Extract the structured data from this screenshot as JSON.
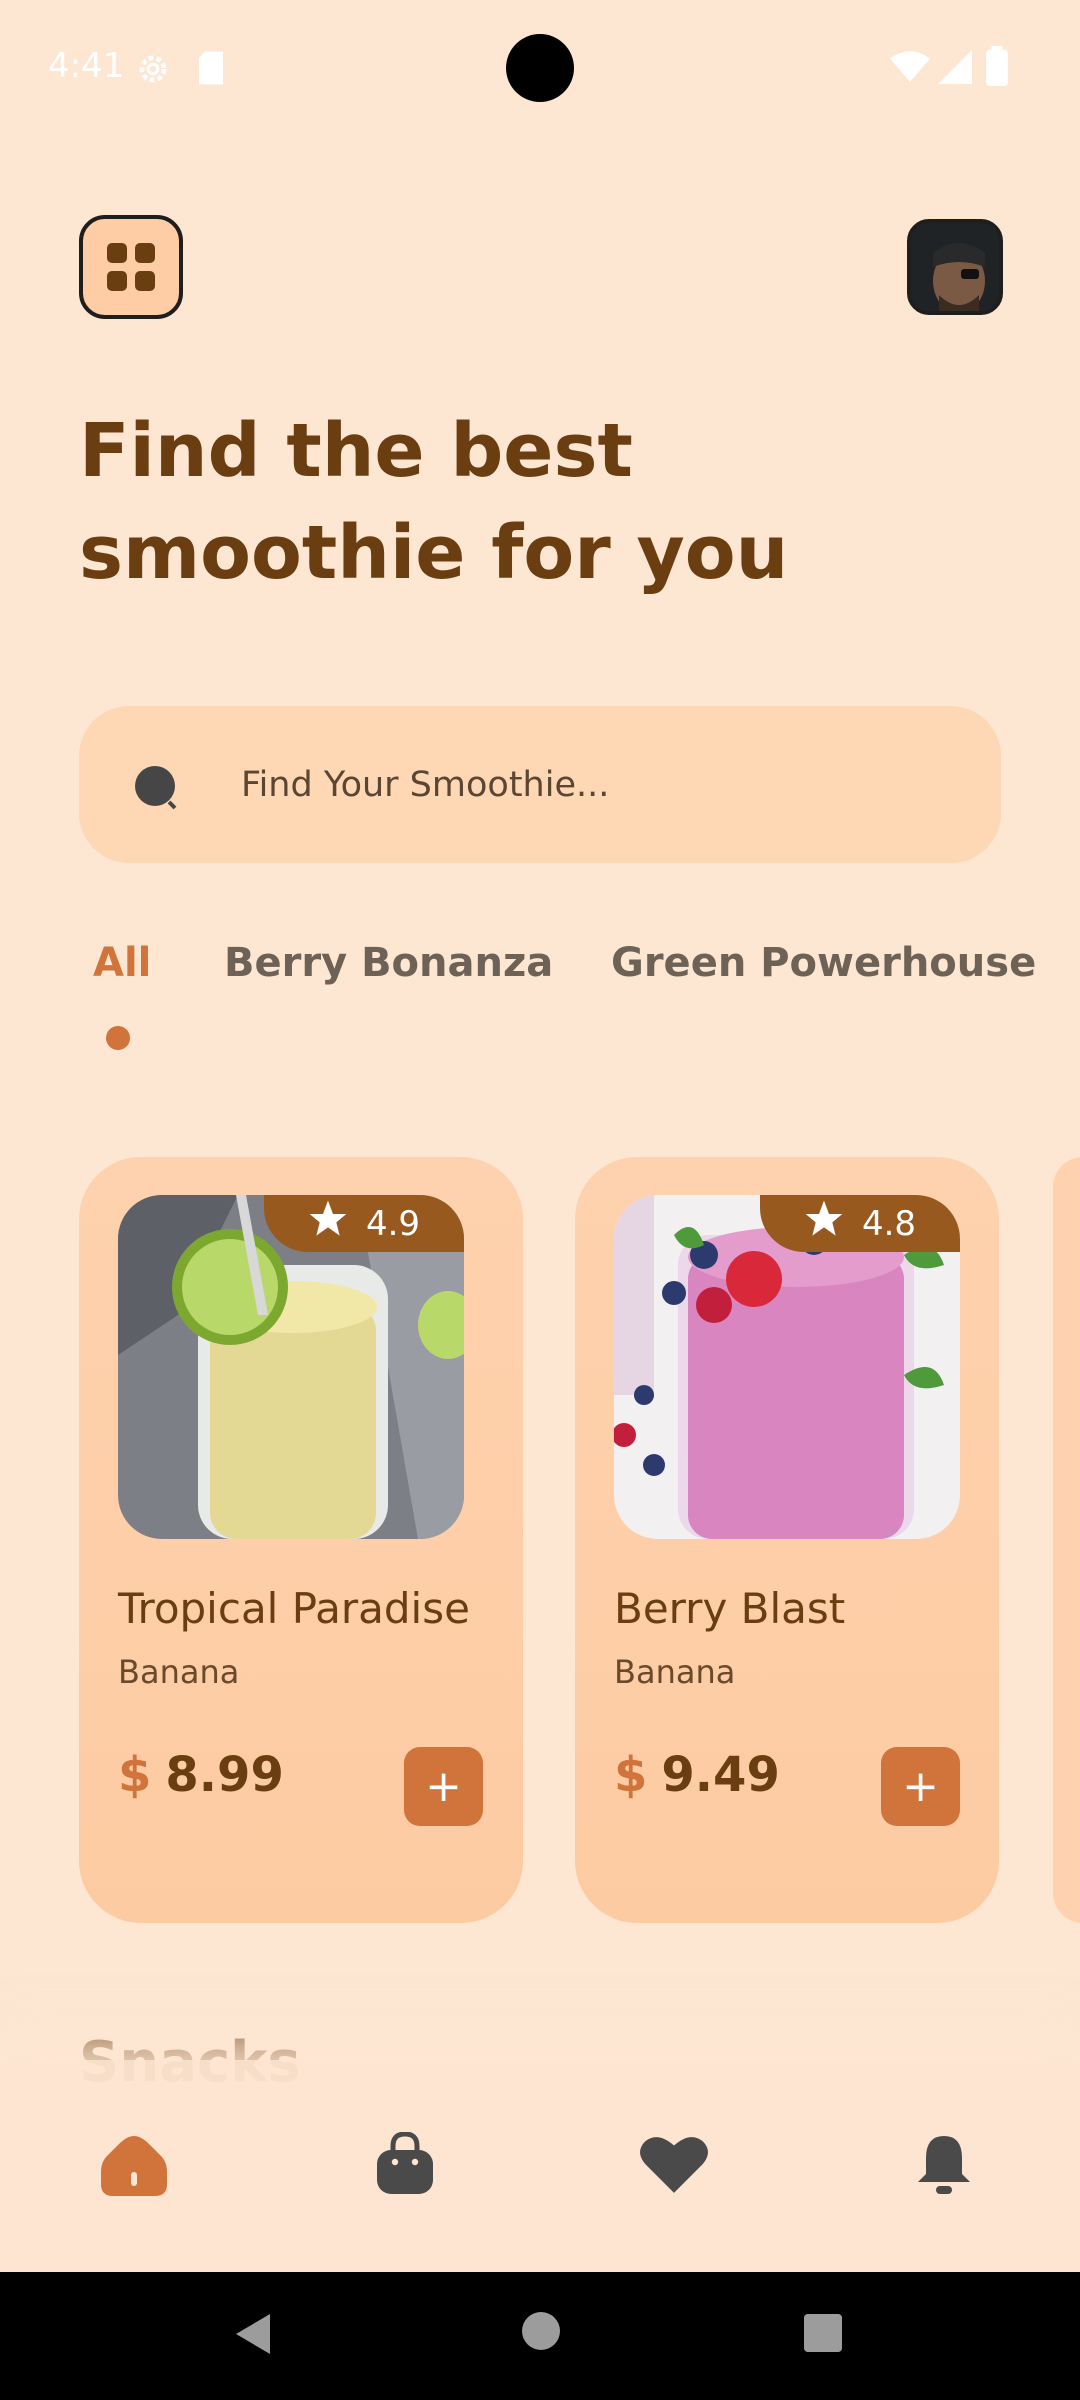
{
  "status_bar": {
    "time": "4:41",
    "icons": [
      "settings-icon",
      "sd-card-icon",
      "wifi-icon",
      "signal-icon",
      "battery-icon"
    ]
  },
  "header": {
    "menu_icon": "grid-menu-icon",
    "avatar": "user-avatar"
  },
  "headline": {
    "line1": "Find the best",
    "line2": "smoothie for you"
  },
  "search": {
    "placeholder": "Find Your Smoothie...",
    "icon": "search-icon"
  },
  "categories": [
    {
      "label": "All",
      "active": true
    },
    {
      "label": "Berry Bonanza",
      "active": false
    },
    {
      "label": "Green Powerhouse",
      "active": false
    }
  ],
  "products": [
    {
      "name": "Tropical Paradise",
      "subtitle": "Banana",
      "currency": "$",
      "price": "8.99",
      "rating": "4.9"
    },
    {
      "name": "Berry Blast",
      "subtitle": "Banana",
      "currency": "$",
      "price": "9.49",
      "rating": "4.8"
    }
  ],
  "section": {
    "title": "Snacks"
  },
  "bottom_nav": {
    "items": [
      "home-icon",
      "bag-icon",
      "heart-icon",
      "bell-icon"
    ],
    "active": "home-icon"
  },
  "colors": {
    "background": "#FDE6D2",
    "accent": "#D0743C",
    "text_primary": "#6B3E12",
    "card": "#FED2AE",
    "rating_badge": "#98591F"
  }
}
